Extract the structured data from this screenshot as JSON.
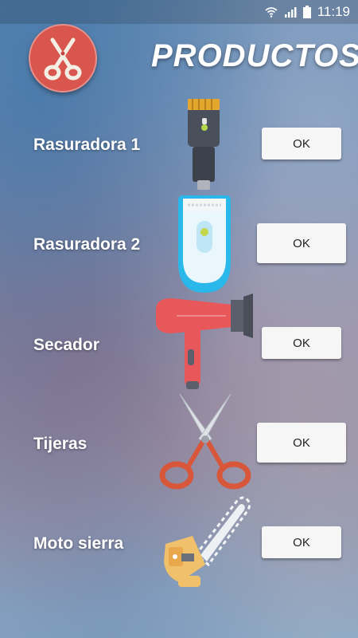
{
  "status_bar": {
    "time": "11:19",
    "icons": [
      "wifi-icon",
      "signal-icon",
      "battery-icon"
    ]
  },
  "header": {
    "title": "PRODUCTOS",
    "logo_icon": "scissors-icon"
  },
  "products": [
    {
      "label": "Rasuradora 1",
      "button": "OK",
      "icon": "trimmer-icon"
    },
    {
      "label": "Rasuradora 2",
      "button": "OK",
      "icon": "shaver-icon"
    },
    {
      "label": "Secador",
      "button": "OK",
      "icon": "hair-dryer-icon"
    },
    {
      "label": "Tijeras",
      "button": "OK",
      "icon": "scissors-icon"
    },
    {
      "label": "Moto sierra",
      "button": "OK",
      "icon": "chainsaw-icon"
    }
  ],
  "colors": {
    "logo_bg": "#d9564f",
    "scissors_red": "#d8563a",
    "dryer_red": "#e8575a",
    "shaver_blue": "#29b6e8",
    "chainsaw_yellow": "#f0c06a"
  }
}
